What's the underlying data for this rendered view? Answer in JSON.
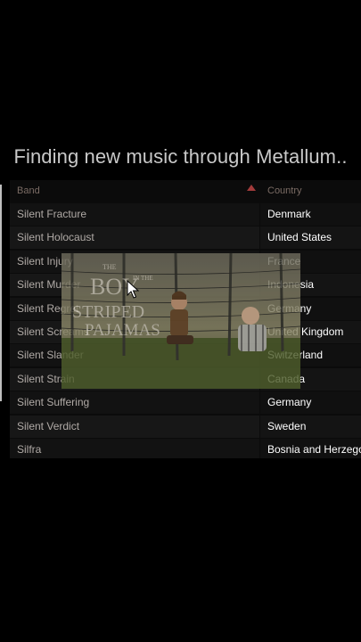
{
  "caption": "Finding new music through Metallum..",
  "table": {
    "headers": {
      "band": "Band",
      "country": "Country"
    },
    "rows": [
      {
        "band": "Silent Fracture",
        "country": "Denmark"
      },
      {
        "band": "Silent Holocaust",
        "country": "United States"
      },
      {
        "band": "Silent Injury",
        "country": "France"
      },
      {
        "band": "Silent Murder",
        "country": "Indonesia"
      },
      {
        "band": "Silent Regret",
        "country": "Germany"
      },
      {
        "band": "Silent Screams",
        "country": "United Kingdom"
      },
      {
        "band": "Silent Slander",
        "country": "Switzerland"
      },
      {
        "band": "Silent Strain",
        "country": "Canada"
      },
      {
        "band": "Silent Suffering",
        "country": "Germany"
      },
      {
        "band": "Silent Verdict",
        "country": "Sweden"
      },
      {
        "band": "Silfra",
        "country": "Bosnia and Herzegovina"
      }
    ]
  },
  "poster": {
    "title_lines": [
      "THE",
      "BOY",
      "IN THE",
      "STRIPED",
      "PAJAMAS"
    ]
  },
  "colors": {
    "caption": "#c9c9c9",
    "sort_arrow": "#a23b3b"
  }
}
